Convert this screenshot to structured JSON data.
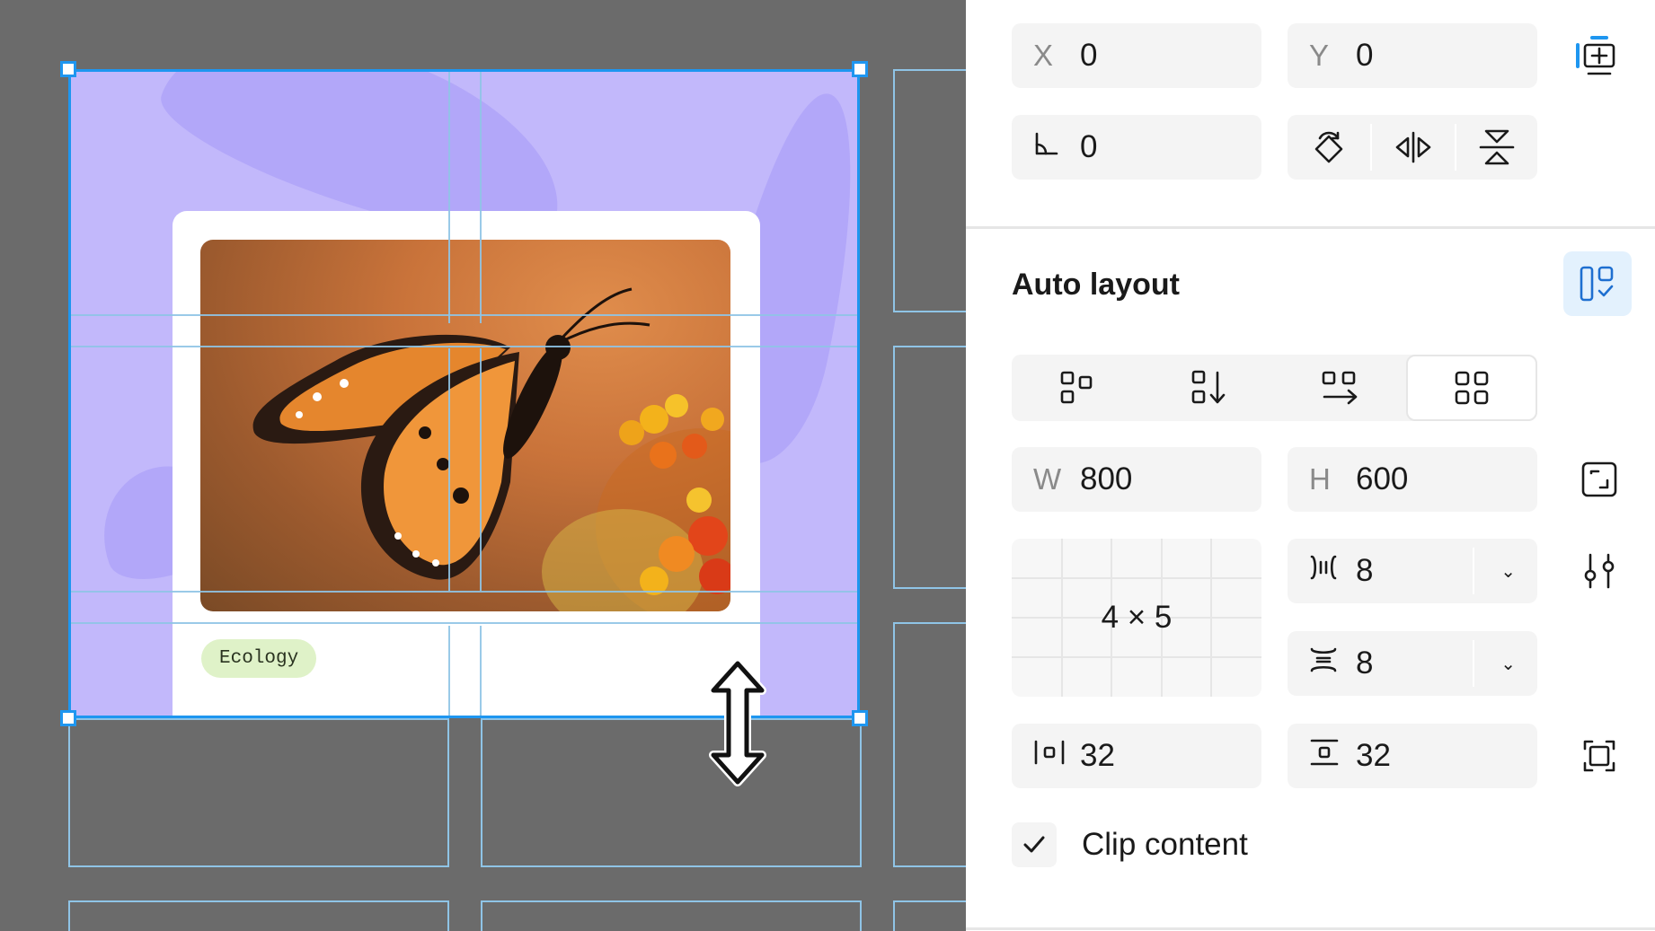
{
  "canvas": {
    "tag_label": "Ecology"
  },
  "panel": {
    "position": {
      "x_label": "X",
      "x_value": "0",
      "y_label": "Y",
      "y_value": "0"
    },
    "rotation": {
      "value": "0"
    },
    "auto_layout": {
      "title": "Auto layout",
      "directions": [
        "wrap",
        "vertical",
        "horizontal",
        "grid"
      ],
      "selected_direction": "grid",
      "width_label": "W",
      "width_value": "800",
      "height_label": "H",
      "height_value": "600",
      "grid_rows_cols": "4 × 5",
      "column_gap": "8",
      "row_gap": "8",
      "horizontal_padding": "32",
      "vertical_padding": "32",
      "clip_content_label": "Clip content",
      "clip_content_checked": true
    }
  },
  "colors": {
    "accent": "#1e96f0",
    "frame_fill": "#c2b8fb",
    "canvas_bg": "#6b6b6b",
    "tag_bg": "#dff2c8"
  }
}
